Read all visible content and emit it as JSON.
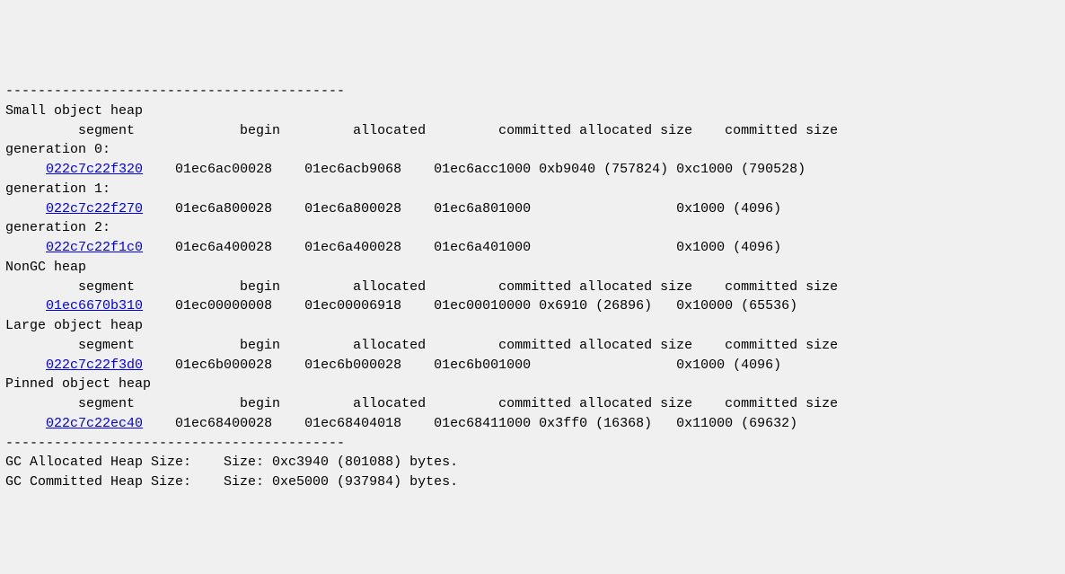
{
  "dashes": "------------------------------------------",
  "soh": {
    "label": "Small object heap",
    "header": "         segment             begin         allocated         committed allocated size    committed size",
    "gen0": {
      "label": "generation 0:",
      "indent": "     ",
      "segment": "022c7c22f320",
      "row_rest": "    01ec6ac00028    01ec6acb9068    01ec6acc1000 0xb9040 (757824) 0xc1000 (790528)"
    },
    "gen1": {
      "label": "generation 1:",
      "indent": "     ",
      "segment": "022c7c22f270",
      "row_rest": "    01ec6a800028    01ec6a800028    01ec6a801000                  0x1000 (4096)"
    },
    "gen2": {
      "label": "generation 2:",
      "indent": "     ",
      "segment": "022c7c22f1c0",
      "row_rest": "    01ec6a400028    01ec6a400028    01ec6a401000                  0x1000 (4096)"
    }
  },
  "nongc": {
    "label": "NonGC heap",
    "header": "         segment             begin         allocated         committed allocated size    committed size",
    "indent": "     ",
    "segment": "01ec6670b310",
    "row_rest": "    01ec00000008    01ec00006918    01ec00010000 0x6910 (26896)   0x10000 (65536)"
  },
  "loh": {
    "label": "Large object heap",
    "header": "         segment             begin         allocated         committed allocated size    committed size",
    "indent": "     ",
    "segment": "022c7c22f3d0",
    "row_rest": "    01ec6b000028    01ec6b000028    01ec6b001000                  0x1000 (4096)"
  },
  "poh": {
    "label": "Pinned object heap",
    "header": "         segment             begin         allocated         committed allocated size    committed size",
    "indent": "     ",
    "segment": "022c7c22ec40",
    "row_rest": "    01ec68400028    01ec68404018    01ec68411000 0x3ff0 (16368)   0x11000 (69632)"
  },
  "totals": {
    "allocated": "GC Allocated Heap Size:    Size: 0xc3940 (801088) bytes.",
    "committed": "GC Committed Heap Size:    Size: 0xe5000 (937984) bytes."
  },
  "chart_data": {
    "type": "table",
    "title": "GC Heap Segment Layout",
    "columns": [
      "heap",
      "generation",
      "segment",
      "begin",
      "allocated",
      "committed",
      "allocated_size_hex",
      "allocated_size_dec",
      "committed_size_hex",
      "committed_size_dec"
    ],
    "rows": [
      [
        "Small object heap",
        "0",
        "022c7c22f320",
        "01ec6ac00028",
        "01ec6acb9068",
        "01ec6acc1000",
        "0xb9040",
        757824,
        "0xc1000",
        790528
      ],
      [
        "Small object heap",
        "1",
        "022c7c22f270",
        "01ec6a800028",
        "01ec6a800028",
        "01ec6a801000",
        null,
        null,
        "0x1000",
        4096
      ],
      [
        "Small object heap",
        "2",
        "022c7c22f1c0",
        "01ec6a400028",
        "01ec6a400028",
        "01ec6a401000",
        null,
        null,
        "0x1000",
        4096
      ],
      [
        "NonGC heap",
        null,
        "01ec6670b310",
        "01ec00000008",
        "01ec00006918",
        "01ec00010000",
        "0x6910",
        26896,
        "0x10000",
        65536
      ],
      [
        "Large object heap",
        null,
        "022c7c22f3d0",
        "01ec6b000028",
        "01ec6b000028",
        "01ec6b001000",
        null,
        null,
        "0x1000",
        4096
      ],
      [
        "Pinned object heap",
        null,
        "022c7c22ec40",
        "01ec68400028",
        "01ec68404018",
        "01ec68411000",
        "0x3ff0",
        16368,
        "0x11000",
        69632
      ]
    ],
    "totals": {
      "gc_allocated_hex": "0xc3940",
      "gc_allocated_bytes": 801088,
      "gc_committed_hex": "0xe5000",
      "gc_committed_bytes": 937984
    }
  }
}
